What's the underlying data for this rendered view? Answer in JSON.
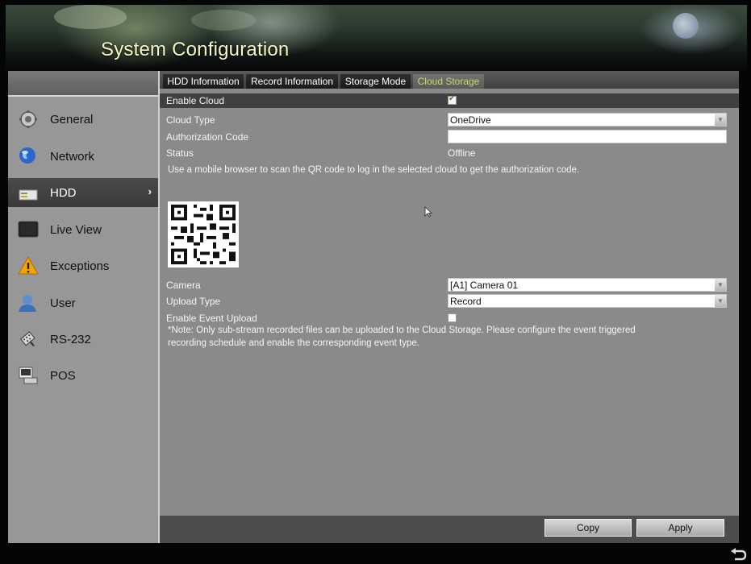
{
  "app": {
    "title": "System Configuration"
  },
  "sidebar": {
    "items": [
      {
        "label": "General",
        "icon": "gear-icon"
      },
      {
        "label": "Network",
        "icon": "globe-icon"
      },
      {
        "label": "HDD",
        "icon": "hdd-icon",
        "active": true,
        "chevron": "›"
      },
      {
        "label": "Live View",
        "icon": "monitor-icon"
      },
      {
        "label": "Exceptions",
        "icon": "warning-icon"
      },
      {
        "label": "User",
        "icon": "user-icon"
      },
      {
        "label": "RS-232",
        "icon": "serial-cable-icon"
      },
      {
        "label": "POS",
        "icon": "pos-terminal-icon"
      }
    ]
  },
  "tabs": [
    {
      "label": "HDD Information"
    },
    {
      "label": "Record Information"
    },
    {
      "label": "Storage Mode"
    },
    {
      "label": "Cloud Storage",
      "active": true
    }
  ],
  "form": {
    "enable_cloud_label": "Enable Cloud",
    "enable_cloud_checked": true,
    "cloud_type_label": "Cloud Type",
    "cloud_type_value": "OneDrive",
    "auth_code_label": "Authorization Code",
    "auth_code_value": "",
    "status_label": "Status",
    "status_value": "Offline",
    "qr_instruction": "Use a mobile browser to scan the QR code to log in the selected cloud to get the authorization code.",
    "camera_label": "Camera",
    "camera_value": "[A1] Camera 01",
    "upload_type_label": "Upload Type",
    "upload_type_value": "Record",
    "event_upload_label": "Enable Event Upload",
    "event_upload_checked": false,
    "note_line1": "*Note: Only sub-stream recorded files can be uploaded to the Cloud Storage. Please configure the event triggered",
    "note_line2": "recording schedule and enable the corresponding event type."
  },
  "buttons": {
    "copy": "Copy",
    "apply": "Apply"
  },
  "colors": {
    "title": "#f4f9c4",
    "active_tab": "#c9d96a",
    "sidebar_bg": "#979797",
    "content_bg": "#8a8a8a",
    "active_nav_bg": "#404040"
  }
}
